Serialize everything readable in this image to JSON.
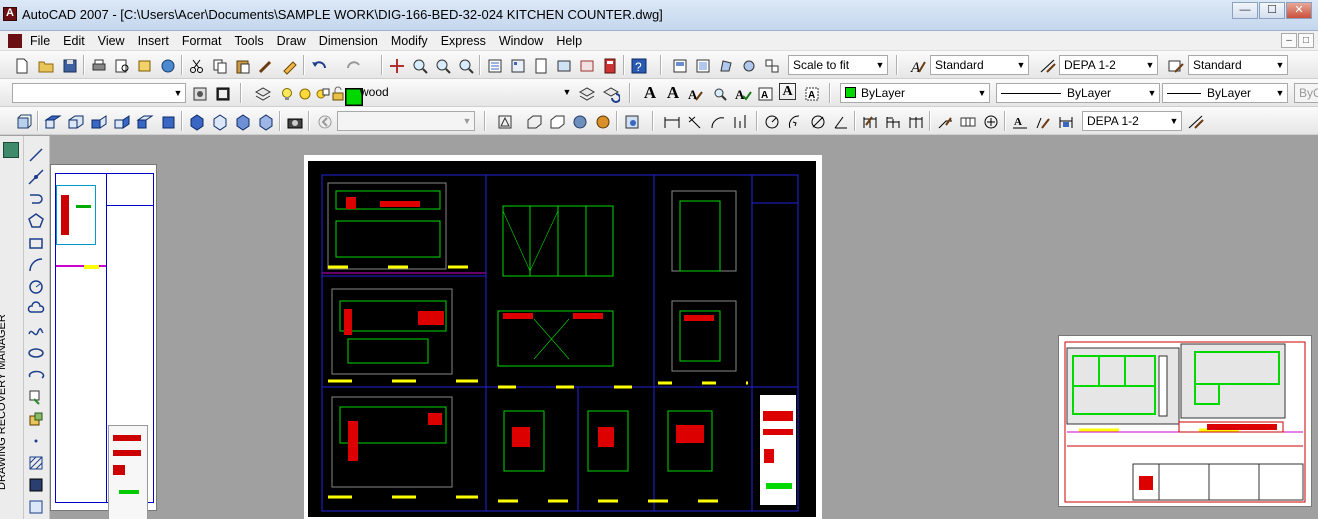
{
  "window": {
    "title": "AutoCAD 2007 - [C:\\Users\\Acer\\Documents\\SAMPLE WORK\\DIG-166-BED-32-024 KITCHEN COUNTER.dwg]",
    "minimize": "—",
    "maximize": "☐",
    "close": "✕"
  },
  "menu": {
    "items": [
      "File",
      "Edit",
      "View",
      "Insert",
      "Format",
      "Tools",
      "Draw",
      "Dimension",
      "Modify",
      "Express",
      "Window",
      "Help"
    ],
    "mdi_minimize": "–",
    "mdi_restore": "□"
  },
  "toolbar1": {
    "zoom_scale": "Scale to fit",
    "text_style": "Standard",
    "dim_style": "DEPA 1-2",
    "table_style": "Standard"
  },
  "toolbar2": {
    "workspace": "",
    "layer": "wood",
    "text_letters": [
      "A",
      "A",
      "A"
    ],
    "color": "ByLayer",
    "linetype": "ByLayer",
    "lineweight": "ByLayer",
    "plot_style": "ByC"
  },
  "toolbar3": {
    "visual_style": "",
    "dim_style": "DEPA 1-2"
  },
  "sidebar": {
    "recovery_manager": "DRAWING RECOVERY MANAGER"
  },
  "colors": {
    "green_layer": "#00d800",
    "drawing_bg": "#000000",
    "canvas_bg": "#a0a0a0"
  }
}
